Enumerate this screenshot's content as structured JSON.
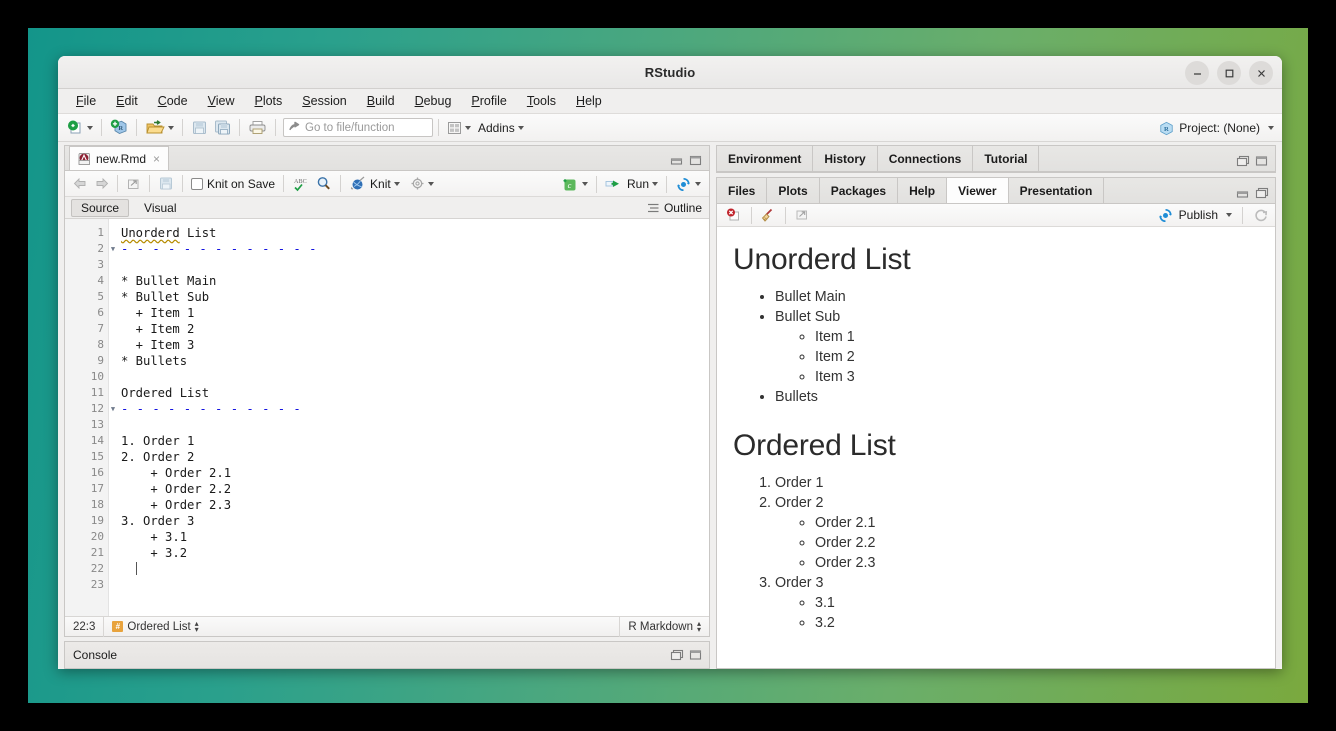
{
  "window": {
    "title": "RStudio",
    "minimize_label": "Minimize",
    "maximize_label": "Maximize",
    "close_label": "Close"
  },
  "menubar": {
    "items": [
      {
        "label": "File",
        "mnemonic": "F"
      },
      {
        "label": "Edit",
        "mnemonic": "E"
      },
      {
        "label": "Code",
        "mnemonic": "C"
      },
      {
        "label": "View",
        "mnemonic": "V"
      },
      {
        "label": "Plots",
        "mnemonic": "P"
      },
      {
        "label": "Session",
        "mnemonic": "S"
      },
      {
        "label": "Build",
        "mnemonic": "B"
      },
      {
        "label": "Debug",
        "mnemonic": "D"
      },
      {
        "label": "Profile",
        "mnemonic": "P"
      },
      {
        "label": "Tools",
        "mnemonic": "T"
      },
      {
        "label": "Help",
        "mnemonic": "H"
      }
    ]
  },
  "toolbar": {
    "new_file_icon": "new-file-icon",
    "new_project_icon": "new-project-icon",
    "open_file_icon": "open-folder-icon",
    "save_icon": "save-icon",
    "save_all_icon": "save-all-icon",
    "print_icon": "print-icon",
    "goto_placeholder": "Go to file/function",
    "goto_value": "",
    "workspace_panes_icon": "pane-layout-icon",
    "addins_label": "Addins",
    "project_label": "Project: (None)",
    "project_icon": "r-cube-icon"
  },
  "source_pane": {
    "tab": {
      "name": "new.Rmd",
      "close_label": "×",
      "icon": "rmd-file-icon"
    },
    "editor_toolbar": {
      "back_icon": "back-arrow-icon",
      "forward_icon": "forward-arrow-icon",
      "popout_icon": "show-in-new-window-icon",
      "save_icon": "save-icon",
      "knit_on_save_label": "Knit on Save",
      "knit_on_save_checked": false,
      "spellcheck_icon": "abc-spellcheck-icon",
      "find_icon": "magnifier-icon",
      "knit_label": "Knit",
      "knit_icon": "knit-yarn-icon",
      "gear_icon": "gear-icon",
      "insert_chunk_icon": "insert-chunk-icon",
      "run_label": "Run",
      "run_icon": "run-arrow-icon",
      "rerun_icon": "rerun-chunks-icon"
    },
    "mode": {
      "source_label": "Source",
      "visual_label": "Visual",
      "active": "Source",
      "outline_label": "Outline",
      "outline_icon": "outline-icon"
    },
    "code_lines": [
      {
        "n": 1,
        "text": "Unorderd List",
        "type": "heading-text",
        "misspelled": "Unorderd",
        "fold": false
      },
      {
        "n": 2,
        "text": "-------------",
        "type": "setext-rule",
        "fold": true
      },
      {
        "n": 3,
        "text": "",
        "type": "blank",
        "fold": false
      },
      {
        "n": 4,
        "text": "* Bullet Main",
        "type": "code",
        "fold": false
      },
      {
        "n": 5,
        "text": "* Bullet Sub",
        "type": "code",
        "fold": false
      },
      {
        "n": 6,
        "text": "  + Item 1",
        "type": "code",
        "fold": false
      },
      {
        "n": 7,
        "text": "  + Item 2",
        "type": "code",
        "fold": false
      },
      {
        "n": 8,
        "text": "  + Item 3",
        "type": "code",
        "fold": false
      },
      {
        "n": 9,
        "text": "* Bullets",
        "type": "code",
        "fold": false
      },
      {
        "n": 10,
        "text": "",
        "type": "blank",
        "fold": false
      },
      {
        "n": 11,
        "text": "Ordered List",
        "type": "code",
        "fold": false
      },
      {
        "n": 12,
        "text": "------------",
        "type": "setext-rule",
        "fold": true
      },
      {
        "n": 13,
        "text": "",
        "type": "blank",
        "fold": false
      },
      {
        "n": 14,
        "text": "1. Order 1",
        "type": "code",
        "fold": false
      },
      {
        "n": 15,
        "text": "2. Order 2",
        "type": "code",
        "fold": false
      },
      {
        "n": 16,
        "text": "    + Order 2.1",
        "type": "code",
        "fold": false
      },
      {
        "n": 17,
        "text": "    + Order 2.2",
        "type": "code",
        "fold": false
      },
      {
        "n": 18,
        "text": "    + Order 2.3",
        "type": "code",
        "fold": false
      },
      {
        "n": 19,
        "text": "3. Order 3",
        "type": "code",
        "fold": false
      },
      {
        "n": 20,
        "text": "    + 3.1",
        "type": "code",
        "fold": false
      },
      {
        "n": 21,
        "text": "    + 3.2",
        "type": "code",
        "fold": false
      },
      {
        "n": 22,
        "text": "  ",
        "type": "cursor",
        "fold": false
      },
      {
        "n": 23,
        "text": "",
        "type": "blank",
        "fold": false
      }
    ],
    "status": {
      "cursor_position": "22:3",
      "scope": "Ordered List",
      "scope_icon": "chunk-hash-icon",
      "file_type": "R Markdown"
    }
  },
  "console_pane": {
    "label": "Console"
  },
  "environment_pane": {
    "tabs": [
      {
        "label": "Environment",
        "active": false
      },
      {
        "label": "History",
        "active": false
      },
      {
        "label": "Connections",
        "active": false
      },
      {
        "label": "Tutorial",
        "active": false
      }
    ]
  },
  "viewer_pane": {
    "tabs": [
      {
        "label": "Files",
        "active": false
      },
      {
        "label": "Plots",
        "active": false
      },
      {
        "label": "Packages",
        "active": false
      },
      {
        "label": "Help",
        "active": false
      },
      {
        "label": "Viewer",
        "active": true
      },
      {
        "label": "Presentation",
        "active": false
      }
    ],
    "toolbar": {
      "stop_icon": "stop-icon",
      "clear_icon": "broom-clear-icon",
      "popout_icon": "show-in-new-window-icon",
      "publish_label": "Publish",
      "publish_icon": "publish-icon",
      "refresh_icon": "refresh-icon"
    },
    "content": {
      "heading1": "Unorderd List",
      "unordered_list": [
        {
          "text": "Bullet Main",
          "children": []
        },
        {
          "text": "Bullet Sub",
          "children": [
            "Item 1",
            "Item 2",
            "Item 3"
          ]
        },
        {
          "text": "Bullets",
          "children": []
        }
      ],
      "heading2": "Ordered List",
      "ordered_list": [
        {
          "text": "Order 1",
          "children": []
        },
        {
          "text": "Order 2",
          "children": [
            "Order 2.1",
            "Order 2.2",
            "Order 2.3"
          ]
        },
        {
          "text": "Order 3",
          "children": [
            "3.1",
            "3.2"
          ]
        }
      ]
    }
  },
  "colors": {
    "desktop_left": "#13958a",
    "desktop_right": "#7aa93e",
    "chrome": "#f0efee",
    "accent_blue": "#1f8dd6",
    "rule_blue": "#1414e0",
    "misspell": "#b58b00",
    "chunk_orange": "#e8a33d"
  }
}
